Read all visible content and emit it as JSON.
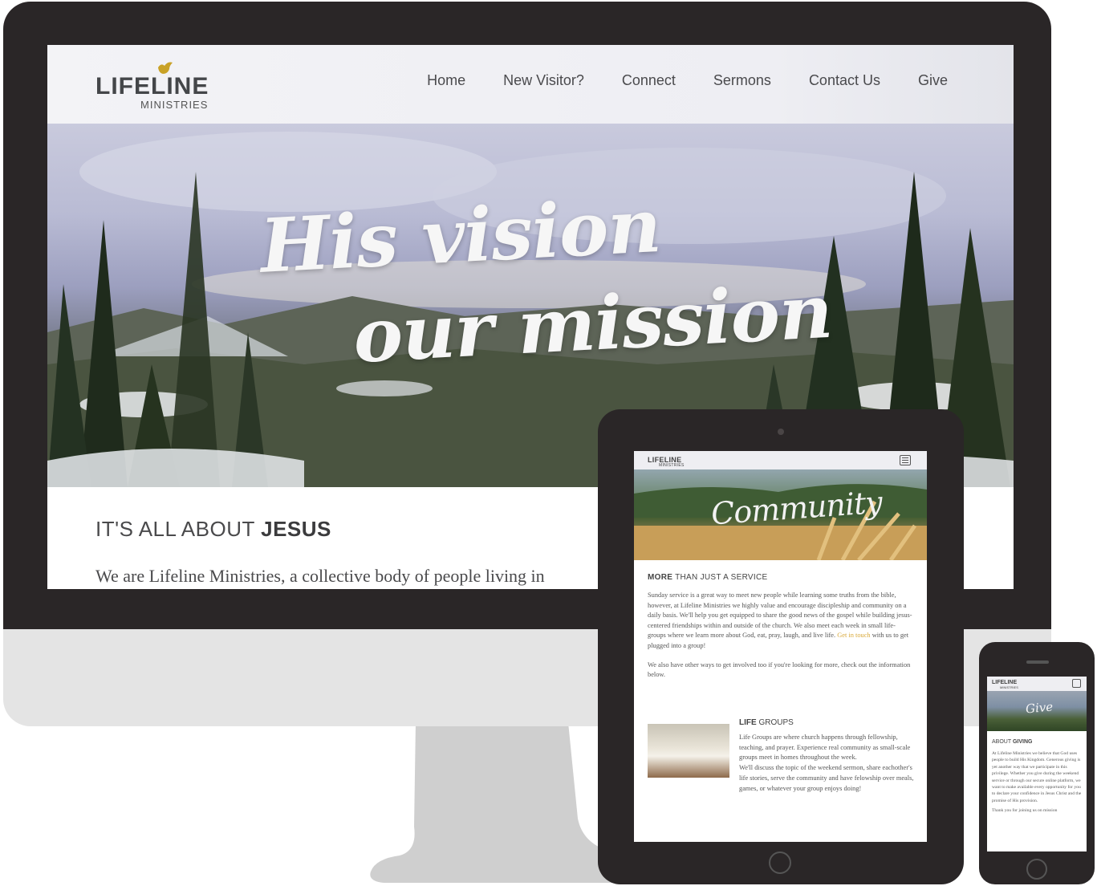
{
  "desktop": {
    "logo": {
      "word": "LIFELINE",
      "sub": "MINISTRIES"
    },
    "nav": [
      "Home",
      "New Visitor?",
      "Connect",
      "Sermons",
      "Contact Us",
      "Give"
    ],
    "hero": {
      "line1": "His vision",
      "line2": "our mission"
    },
    "about": {
      "heading_light": "IT'S ALL ABOUT ",
      "heading_bold": "JESUS",
      "text": "We are Lifeline Ministries, a collective body of people living in"
    }
  },
  "tablet": {
    "logo": {
      "word": "LIFELINE",
      "sub": "MINISTRIES"
    },
    "hero_title": "Community",
    "heading_bold": "MORE",
    "heading_light": " THAN JUST A SERVICE",
    "para1_before": "Sunday service is a great way to meet new people while learning some truths from the bible, however, at Lifeline Ministries we highly value and encourage discipleship and community on a daily basis. We'll help you get equipped to share the good news of the gospel while building jesus-centered friendships within and outside of the church. We also meet each week in small life-groups where we learn more about God, eat, pray, laugh, and live life. ",
    "para1_link": "Get in touch",
    "para1_after": " with us to get plugged into a group!",
    "para2": "We also have other ways to get involved too if you're looking for more, check out the information below.",
    "life_groups": {
      "title_bold": "LIFE",
      "title_light": " GROUPS",
      "text1": "Life Groups are where church happens through fellowship, teaching, and prayer. Experience real community as small-scale groups meet in homes throughout the week.",
      "text2": "We'll discuss the topic of the weekend sermon, share eachother's life stories, serve the community and have felowship over meals, games, or whatever your group enjoys doing!"
    }
  },
  "phone": {
    "logo": {
      "word": "LIFELINE",
      "sub": "MINISTRIES"
    },
    "hero_title": "Give",
    "heading_light": "ABOUT ",
    "heading_bold": "GIVING",
    "para1": "At Lifeline Ministries we believe that God uses people to build His Kingdom. Generous giving is yet another way that we participate in this privilege. Whether you give during the weekend service or through our secure online platform, we want to make available every opportunity for you to declare your confidence in Jesus Christ and the promise of His provision.",
    "para2": "Thank you for joining us on mission"
  },
  "colors": {
    "device_frame": "#2a2627",
    "imac_chin": "#e4e4e4",
    "stand": "#cfcfcf",
    "text_dark": "#4a4a4c",
    "link_accent": "#d9a93a",
    "logo_bird": "#c9a227"
  },
  "icons": [
    "lifeline-bird-logo-icon",
    "hamburger-menu-icon"
  ]
}
